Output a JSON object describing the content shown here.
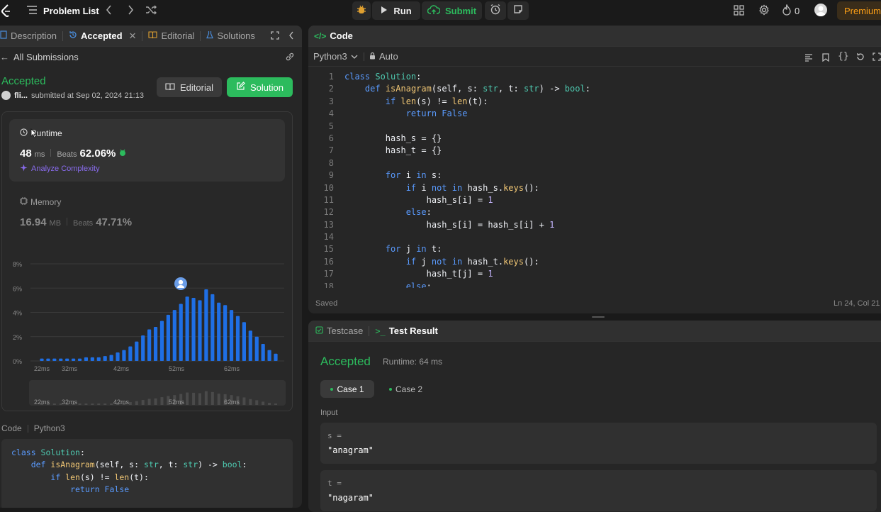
{
  "topbar": {
    "problem_list": "Problem List",
    "run": "Run",
    "submit": "Submit",
    "streak": "0",
    "premium": "Premium"
  },
  "left": {
    "tabs": [
      "Description",
      "Accepted",
      "Editorial",
      "Solutions"
    ],
    "all_submissions": "All Submissions",
    "status": "Accepted",
    "user": "fli...",
    "submitted_at": "submitted at Sep 02, 2024 21:13",
    "editorial_btn": "Editorial",
    "solution_btn": "Solution",
    "runtime": {
      "title": "Runtime",
      "value": "48",
      "unit": "ms",
      "beats_label": "Beats",
      "beats": "62.06%",
      "analyze": "Analyze Complexity"
    },
    "memory": {
      "title": "Memory",
      "value": "16.94",
      "unit": "MB",
      "beats_label": "Beats",
      "beats": "47.71%"
    },
    "code_lang_label": "Code",
    "code_lang": "Python3",
    "code_preview": [
      "class Solution:",
      "    def isAnagram(self, s: str, t: str) -> bool:",
      "        if len(s) != len(t):",
      "            return False"
    ]
  },
  "editor": {
    "title": "Code",
    "lang": "Python3",
    "mode": "Auto",
    "saved": "Saved",
    "cursor": "Ln 24, Col 21",
    "lines": [
      "class Solution:",
      "    def isAnagram(self, s: str, t: str) -> bool:",
      "        if len(s) != len(t):",
      "            return False",
      "",
      "        hash_s = {}",
      "        hash_t = {}",
      "",
      "        for i in s:",
      "            if i not in hash_s.keys():",
      "                hash_s[i] = 1",
      "            else:",
      "                hash_s[i] = hash_s[i] + 1",
      "",
      "        for j in t:",
      "            if j not in hash_t.keys():",
      "                hash_t[j] = 1",
      "            else:"
    ]
  },
  "result": {
    "tab_testcase": "Testcase",
    "tab_result": "Test Result",
    "status": "Accepted",
    "runtime": "Runtime: 64 ms",
    "case1": "Case 1",
    "case2": "Case 2",
    "input_label": "Input",
    "s_label": "s =",
    "s_value": "\"anagram\"",
    "t_label": "t =",
    "t_value": "\"nagaram\""
  },
  "colors": {
    "accent_green": "#2cbb5d",
    "bar_blue": "#1f6fe5",
    "bar_grey": "#4a4a4a",
    "premium": "#ffa116"
  },
  "chart_data": {
    "type": "bar",
    "x_ticks": [
      "22ms",
      "32ms",
      "42ms",
      "52ms",
      "62ms"
    ],
    "y_ticks": [
      "0%",
      "2%",
      "4%",
      "6%",
      "8%"
    ],
    "ylim": [
      0,
      8
    ],
    "x_range": [
      22,
      64
    ],
    "values": [
      0.2,
      0.2,
      0.2,
      0.2,
      0.2,
      0.2,
      0.2,
      0.3,
      0.3,
      0.3,
      0.4,
      0.5,
      0.7,
      0.9,
      1.2,
      1.6,
      2.1,
      2.6,
      2.8,
      3.3,
      3.8,
      4.2,
      4.7,
      5.3,
      5.2,
      5.0,
      5.9,
      5.5,
      4.8,
      4.6,
      4.2,
      3.7,
      3.2,
      2.5,
      2.0,
      1.4,
      0.9,
      0.6
    ],
    "highlight_x": 48
  }
}
